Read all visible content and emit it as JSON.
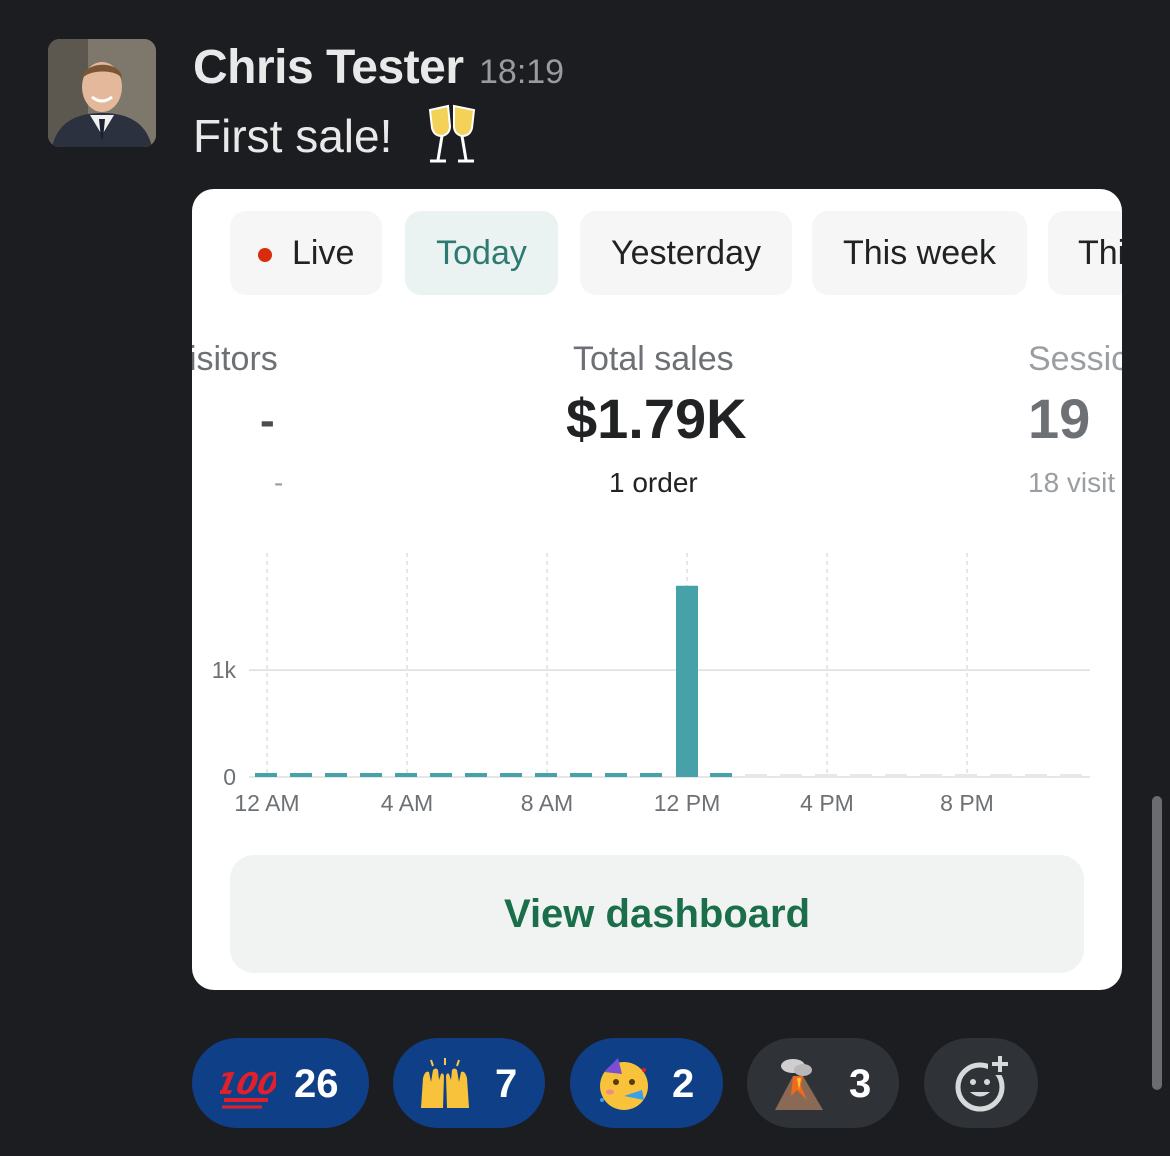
{
  "message": {
    "author": "Chris Tester",
    "time": "18:19",
    "text": "First sale!",
    "emoji": "clinking-glasses"
  },
  "card": {
    "tabs": [
      {
        "label": "Live",
        "live": true
      },
      {
        "label": "Today",
        "active": true
      },
      {
        "label": "Yesterday"
      },
      {
        "label": "This week"
      },
      {
        "label": "Thi"
      }
    ],
    "metrics": [
      {
        "label": "isitors",
        "value": "-",
        "sub": "-"
      },
      {
        "label": "Total sales",
        "value": "$1.79K",
        "sub": "1 order"
      },
      {
        "label": "Sessic",
        "value": "19",
        "sub": "18 visit"
      }
    ],
    "button": "View dashboard"
  },
  "chart_data": {
    "type": "bar",
    "y_tick_labels": [
      "0",
      "1k"
    ],
    "x_tick_labels": [
      "12 AM",
      "4 AM",
      "8 AM",
      "12 PM",
      "4 PM",
      "8 PM"
    ],
    "ylim": [
      0,
      1900
    ],
    "hours": [
      0,
      1,
      2,
      3,
      4,
      5,
      6,
      7,
      8,
      9,
      10,
      11,
      12,
      13,
      14,
      15,
      16,
      17,
      18,
      19,
      20,
      21,
      22,
      23
    ],
    "values": [
      0,
      0,
      0,
      0,
      0,
      0,
      0,
      0,
      0,
      0,
      0,
      0,
      1790,
      0,
      null,
      null,
      null,
      null,
      null,
      null,
      null,
      null,
      null,
      null
    ],
    "colors": {
      "bar": "#47a1a8",
      "future": "#e6e8ea",
      "grid": "#dcdde0"
    }
  },
  "reactions": [
    {
      "emoji": "hundred-points",
      "count": "26",
      "mine": true
    },
    {
      "emoji": "raising-hands",
      "count": "7",
      "mine": true
    },
    {
      "emoji": "partying-face",
      "count": "2",
      "mine": true
    },
    {
      "emoji": "volcano",
      "count": "3",
      "mine": false
    }
  ],
  "add_reaction": "add-reaction-icon"
}
